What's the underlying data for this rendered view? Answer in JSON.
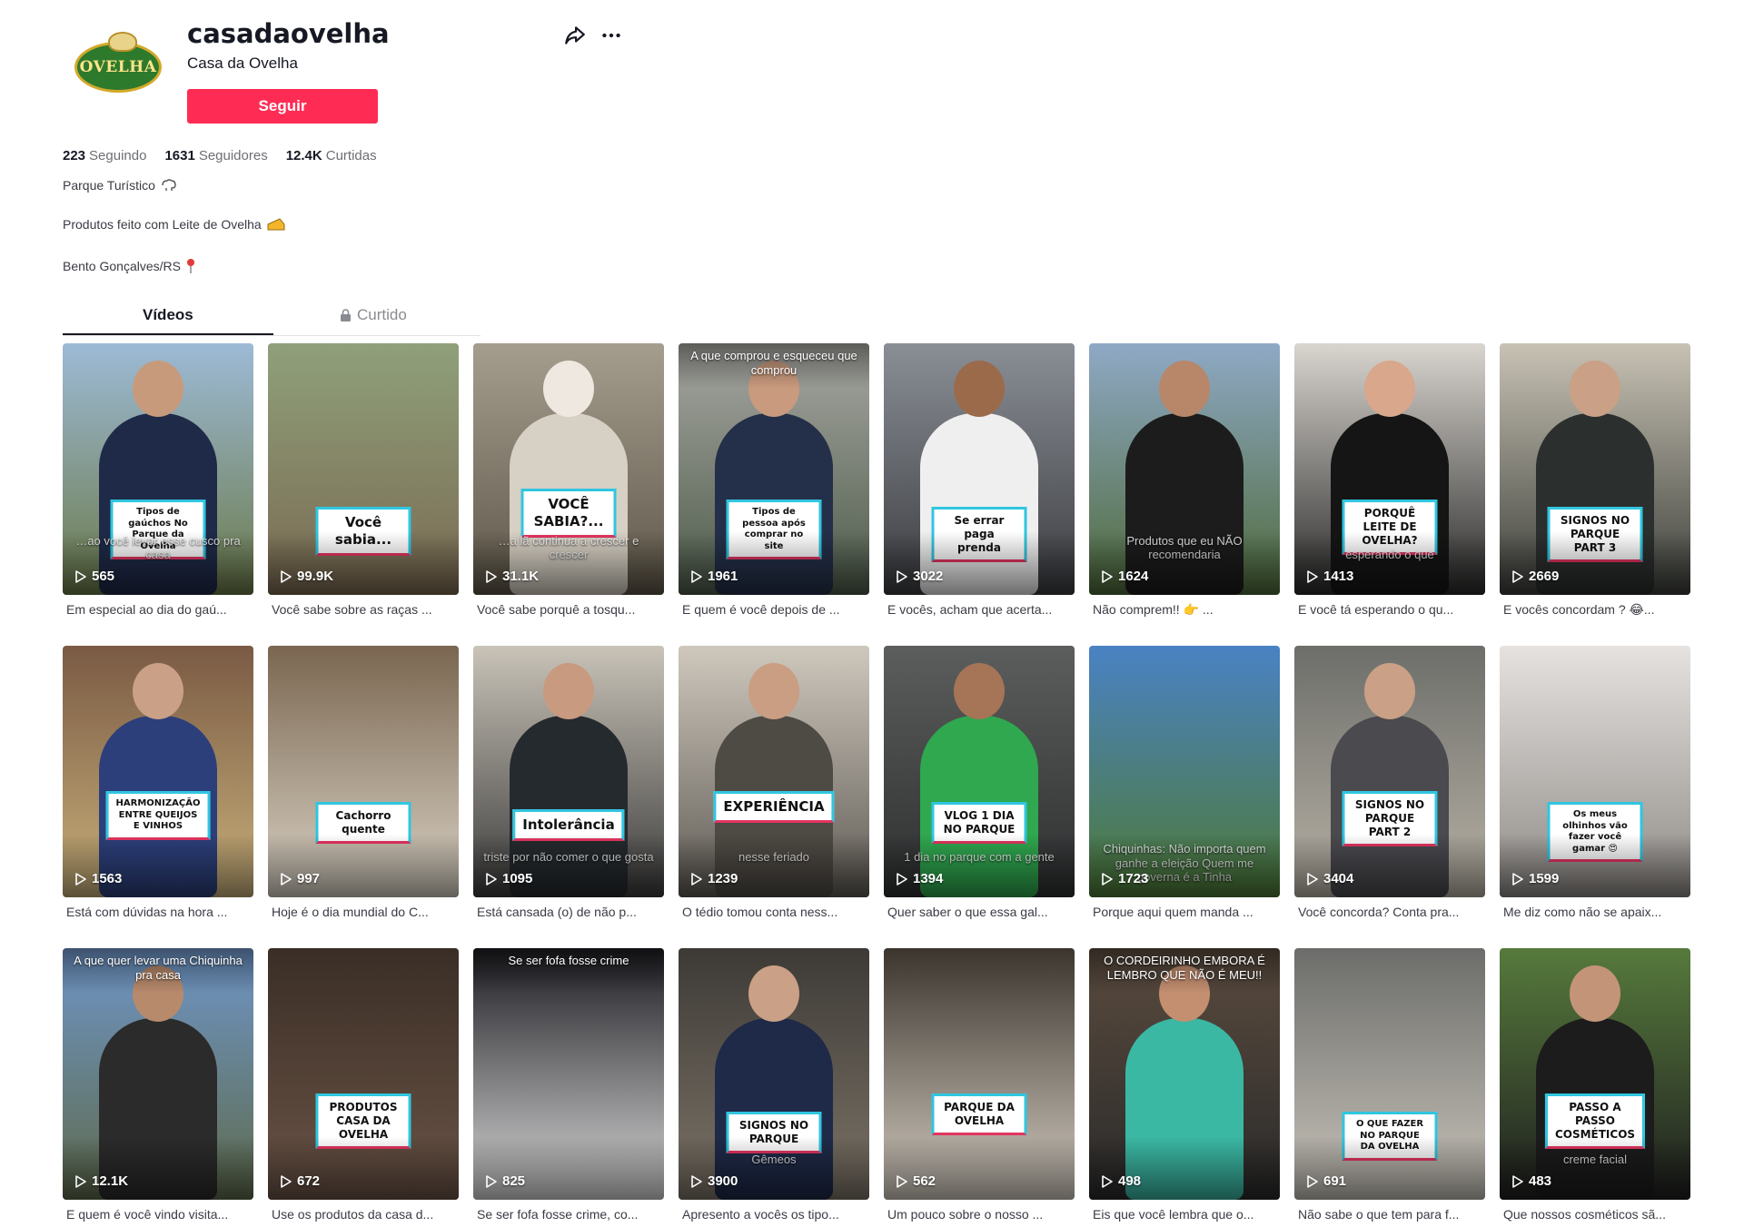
{
  "profile": {
    "username": "casadaovelha",
    "nickname": "Casa da Ovelha",
    "avatar_text": "OVELHA",
    "follow_label": "Seguir",
    "share_icon": "share-icon",
    "more_icon": "more-icon"
  },
  "stats": [
    {
      "value": "223",
      "label": "Seguindo"
    },
    {
      "value": "1631",
      "label": "Seguidores"
    },
    {
      "value": "12.4K",
      "label": "Curtidas"
    }
  ],
  "bio": [
    {
      "text": "Parque Turístico",
      "emoji": "sheep-emoji-icon",
      "emoji_color": "#8a8b91"
    },
    {
      "text": "Produtos feito com Leite de Ovelha",
      "emoji": "cheese-emoji-icon",
      "emoji_color": "#f3b62a"
    },
    {
      "text": "Bento Gonçalves/RS",
      "emoji": "pin-emoji-icon",
      "emoji_color": "#e23a3a"
    }
  ],
  "tabs": {
    "videos": "Vídeos",
    "liked": "Curtido"
  },
  "colors": {
    "accent": "#fe2c55",
    "overlay_border_top": "#30c6e0",
    "overlay_border_bottom": "#e33460"
  },
  "videos": [
    {
      "views": "565",
      "caption": "Em especial ao dia do gaú...",
      "overlay": "Tipos de gaúchos No Parque da Ovelha",
      "faint": "…ao você levar esse cusco pra casa",
      "bg": [
        "#9dbad6",
        "#6b7a4a"
      ],
      "subject": "#1f2a48",
      "skin": "#c79a7c"
    },
    {
      "views": "99.9K",
      "caption": "Você sabe sobre as raças ...",
      "overlay": "Você sabia...",
      "faint": "",
      "bg": [
        "#8fa07a",
        "#7a6a52"
      ],
      "subject": "",
      "skin": ""
    },
    {
      "views": "31.1K",
      "caption": "Você sabe porquê a tosqu...",
      "overlay": "VOCÊ SABIA?...",
      "faint": "…a lã continua a crescer e crescer",
      "bg": [
        "#a59d8e",
        "#5e5648"
      ],
      "subject": "#d7d0c4",
      "skin": "#efe8e0"
    },
    {
      "views": "1961",
      "caption": "E quem é você depois de ...",
      "overlay": "Tipos de pessoa após comprar no site",
      "top": "A que comprou e esqueceu que comprou",
      "faint": "",
      "bg": [
        "#a7a7a2",
        "#4d5b4a"
      ],
      "subject": "#243049",
      "skin": "#c99a7e"
    },
    {
      "views": "3022",
      "caption": "E vocês, acham que acerta...",
      "overlay": "Se errar paga prenda",
      "faint": "",
      "bg": [
        "#8a8f96",
        "#3b3c40"
      ],
      "subject": "#efefef",
      "skin": "#9b6a4b"
    },
    {
      "views": "1624",
      "caption": "Não comprem!! 👉 ...",
      "overlay": "",
      "faint": "Produtos que eu NÃO recomendaria",
      "bg": [
        "#8fa9c6",
        "#4e6a3a"
      ],
      "subject": "#1c1c1c",
      "skin": "#b8876a"
    },
    {
      "views": "1413",
      "caption": "E você tá esperando o qu...",
      "overlay": "PORQUÊ LEITE DE OVELHA?",
      "faint": "esperando o que",
      "bg": [
        "#d9d5cf",
        "#2a2a2a"
      ],
      "subject": "#151515",
      "skin": "#d8a78c"
    },
    {
      "views": "2669",
      "caption": "E vocês concordam ? 😂...",
      "overlay": "SIGNOS NO PARQUE PART 3",
      "faint": "",
      "bg": [
        "#c8c2b4",
        "#3c3f3a"
      ],
      "subject": "#2b2f2d",
      "skin": "#caa086"
    },
    {
      "views": "1563",
      "caption": "Está com dúvidas na hora ...",
      "overlay": "HARMONIZAÇÃO ENTRE QUEIJOS E VINHOS",
      "faint": "",
      "bg": [
        "#7a5a44",
        "#c8b07a"
      ],
      "subject": "#2c3f7a",
      "skin": "#caa086"
    },
    {
      "views": "997",
      "caption": "Hoje é o dia mundial do C...",
      "overlay": "Cachorro quente",
      "faint": "",
      "bg": [
        "#7a6650",
        "#d9d2c5"
      ],
      "subject": "",
      "skin": ""
    },
    {
      "views": "1095",
      "caption": "Está cansada (o) de não p...",
      "overlay": "Intolerância",
      "faint": "triste por não comer o que gosta",
      "bg": [
        "#c9c3b8",
        "#3b3b3b"
      ],
      "subject": "#252a2e",
      "skin": "#c89a80"
    },
    {
      "views": "1239",
      "caption": "O tédio tomou conta ness...",
      "overlay": "EXPERIÊNCIA",
      "faint": "nesse feriado",
      "bg": [
        "#cfc8bd",
        "#5e5a54"
      ],
      "subject": "#4e4a44",
      "skin": "#c99e82"
    },
    {
      "views": "1394",
      "caption": "Quer saber o que essa gal...",
      "overlay": "VLOG 1 DIA NO PARQUE",
      "faint": "1 dia no parque com a gente",
      "bg": [
        "#5b5e5c",
        "#2d2f30"
      ],
      "subject": "#2fa84f",
      "skin": "#a67457"
    },
    {
      "views": "1723",
      "caption": "Porque aqui quem manda ...",
      "overlay": "",
      "faint": "Chiquinhas: Não importa quem ganhe a eleição Quem me governa é a Tinha",
      "bg": [
        "#4a82c4",
        "#4d7a36"
      ],
      "subject": "",
      "skin": ""
    },
    {
      "views": "3404",
      "caption": "Você concorda? Conta pra...",
      "overlay": "SIGNOS NO PARQUE PART 2",
      "faint": "",
      "bg": [
        "#6d6e6a",
        "#b8b2a6"
      ],
      "subject": "#4a4a4f",
      "skin": "#caa086"
    },
    {
      "views": "1599",
      "caption": "Me diz como não se apaix...",
      "overlay": "Os meus olhinhos vão fazer você gamar 😍",
      "faint": "",
      "bg": [
        "#e6e2df",
        "#8e8a86"
      ],
      "subject": "",
      "skin": ""
    },
    {
      "views": "12.1K",
      "caption": "E quem é você vindo visita...",
      "overlay": "",
      "top": "A que quer levar uma Chiquinha pra casa",
      "faint": "",
      "bg": [
        "#6e95c7",
        "#5f6b4c"
      ],
      "subject": "#2b2b2b",
      "skin": "#b88a6c"
    },
    {
      "views": "672",
      "caption": "Use os produtos da casa d...",
      "overlay": "PRODUTOS CASA DA OVELHA",
      "faint": "",
      "bg": [
        "#3a2e26",
        "#6b5446"
      ],
      "subject": "",
      "skin": ""
    },
    {
      "views": "825",
      "caption": "Se ser fofa fosse crime, co...",
      "overlay": "",
      "top": "Se ser fofa fosse crime",
      "faint": "",
      "bg": [
        "#1d1d22",
        "#d9d9d9"
      ],
      "subject": "",
      "skin": ""
    },
    {
      "views": "3900",
      "caption": "Apresento a vocês os tipo...",
      "overlay": "SIGNOS NO PARQUE",
      "faint": "Gêmeos",
      "bg": [
        "#3d3a36",
        "#7d7468"
      ],
      "subject": "#1f2a48",
      "skin": "#caa086"
    },
    {
      "views": "562",
      "caption": "Um pouco sobre o nosso ...",
      "overlay": "PARQUE DA OVELHA",
      "faint": "",
      "bg": [
        "#3b352e",
        "#d5cdc2"
      ],
      "subject": "",
      "skin": ""
    },
    {
      "views": "498",
      "caption": "Eis que você lembra que o...",
      "overlay": "",
      "top": "O CORDEIRINHO EMBORA É LEMBRO QUE NÃO É MEU!!",
      "faint": "",
      "bg": [
        "#5a4b3e",
        "#2a2a2a"
      ],
      "subject": "#3bb8a4",
      "skin": "#c48f70"
    },
    {
      "views": "691",
      "caption": "Não sabe o que tem para f...",
      "overlay": "O QUE FAZER NO PARQUE DA OVELHA",
      "faint": "",
      "bg": [
        "#6c6d6a",
        "#c9c4bb"
      ],
      "subject": "",
      "skin": ""
    },
    {
      "views": "483",
      "caption": "Que nossos cosméticos sã...",
      "overlay": "PASSO A PASSO COSMÉTICOS",
      "faint": "creme facial",
      "bg": [
        "#567a3c",
        "#1f1f1f"
      ],
      "subject": "#1c1c1c",
      "skin": "#c49478"
    }
  ]
}
